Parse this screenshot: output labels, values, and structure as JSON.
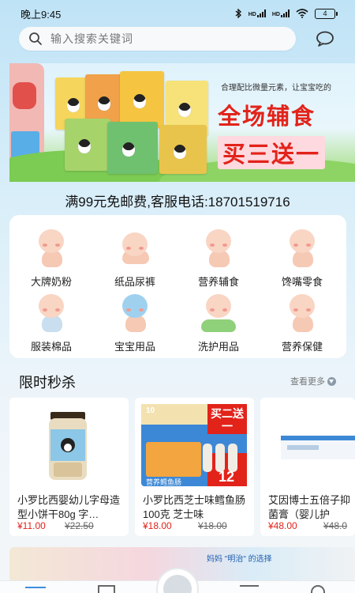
{
  "status_bar": {
    "time": "晚上9:45",
    "network_1": "HD",
    "network_2": "HD",
    "battery": "4"
  },
  "search": {
    "placeholder": "输入搜索关键词",
    "icon": "search-icon"
  },
  "header": {
    "message_icon": "chat-bubble-icon"
  },
  "banner": {
    "tagline": "合理配比微量元素，让宝宝吃的",
    "title": "全场辅食",
    "subtitle": "买三送一"
  },
  "shipping_notice": "满99元免邮费,客服电话:18701519716",
  "categories": [
    {
      "label": "大牌奶粉",
      "icon": "baby-milk-icon"
    },
    {
      "label": "纸品尿裤",
      "icon": "baby-diaper-icon"
    },
    {
      "label": "营养辅食",
      "icon": "baby-food-icon"
    },
    {
      "label": "馋嘴零食",
      "icon": "baby-snack-icon"
    },
    {
      "label": "服装棉品",
      "icon": "baby-clothes-icon"
    },
    {
      "label": "宝宝用品",
      "icon": "baby-supplies-icon"
    },
    {
      "label": "洗护用品",
      "icon": "baby-bath-icon"
    },
    {
      "label": "营养保健",
      "icon": "baby-health-icon"
    }
  ],
  "flash_sale": {
    "title": "限时秒杀",
    "more_label": "查看更多",
    "products": [
      {
        "name": "小罗比西婴幼儿字母造型小饼干80g 字…",
        "price": "¥11.00",
        "old_price": "¥22.50"
      },
      {
        "name": "小罗比西芝士味鳕鱼肠100克 芝士味",
        "price": "¥18.00",
        "old_price": "¥18.00",
        "promo_badge": "买二送一",
        "promo_number": "12",
        "promo_top": "10",
        "promo_caption": "营养鳕鱼肠"
      },
      {
        "name": "艾因博士五倍子抑菌膏（婴儿护",
        "price": "¥48.00",
        "old_price": "¥48.0"
      }
    ]
  },
  "bottom_banner": {
    "text": "妈妈 \"明治\" 的选择"
  },
  "colors": {
    "accent_red": "#e2231a",
    "tab_active": "#3f8de0"
  }
}
